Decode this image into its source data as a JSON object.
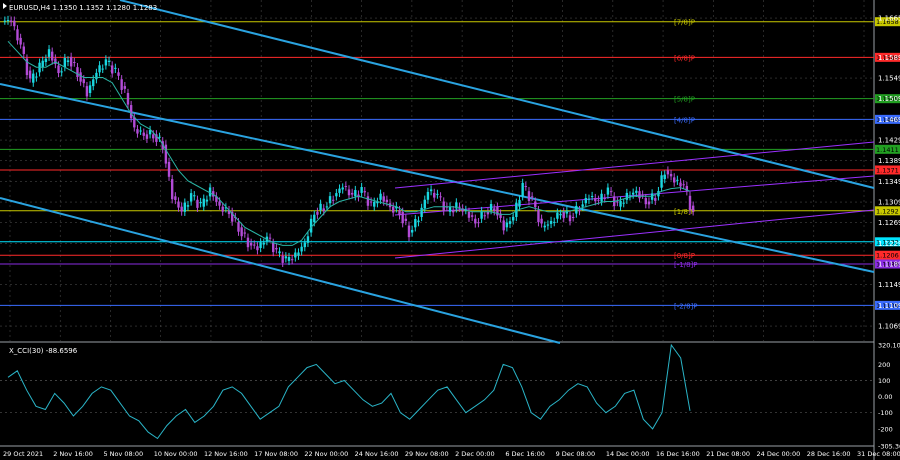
{
  "header": {
    "symbol_line": "EURUSD,H4  1.1350 1.1352 1.1280 1.1283"
  },
  "indicator": {
    "title": "X_CCI(30) -88.6596"
  },
  "chart_data": [
    {
      "type": "candlestick",
      "title": "EURUSD,H4",
      "ylim": [
        1.104,
        1.17
      ],
      "price_ticks": [
        "1.1665",
        "1.1589",
        "1.1549",
        "1.1509",
        "1.1469",
        "1.1429",
        "1.1389",
        "1.1349",
        "1.1309",
        "1.1269",
        "1.1229",
        "1.1189",
        "1.1149",
        "1.1109",
        "1.1069"
      ],
      "x_ticks": [
        "29 Oct 2021",
        "2 Nov 16:00",
        "5 Nov 08:00",
        "10 Nov 00:00",
        "12 Nov 16:00",
        "17 Nov 08:00",
        "22 Nov 00:00",
        "24 Nov 16:00",
        "29 Nov 08:00",
        "2 Dec 00:00",
        "6 Dec 16:00",
        "9 Dec 08:00",
        "14 Dec 00:00",
        "16 Dec 16:00",
        "21 Dec 08:00",
        "24 Dec 00:00",
        "28 Dec 16:00",
        "31 Dec 08:00"
      ],
      "close_path": [
        1.166,
        1.161,
        1.154,
        1.157,
        1.16,
        1.156,
        1.159,
        1.156,
        1.152,
        1.156,
        1.158,
        1.156,
        1.152,
        1.145,
        1.144,
        1.144,
        1.142,
        1.132,
        1.129,
        1.132,
        1.13,
        1.133,
        1.13,
        1.129,
        1.126,
        1.123,
        1.122,
        1.124,
        1.121,
        1.1195,
        1.1205,
        1.123,
        1.129,
        1.13,
        1.132,
        1.134,
        1.132,
        1.133,
        1.13,
        1.132,
        1.13,
        1.129,
        1.125,
        1.128,
        1.133,
        1.132,
        1.129,
        1.13,
        1.129,
        1.127,
        1.129,
        1.13,
        1.126,
        1.128,
        1.134,
        1.131,
        1.126,
        1.127,
        1.129,
        1.128,
        1.13,
        1.132,
        1.131,
        1.133,
        1.13,
        1.132,
        1.133,
        1.131,
        1.132,
        1.137,
        1.135,
        1.134,
        1.1283
      ],
      "ma_path": [
        1.162,
        1.16,
        1.158,
        1.157,
        1.157,
        1.158,
        1.157,
        1.156,
        1.155,
        1.155,
        1.155,
        1.154,
        1.151,
        1.148,
        1.146,
        1.145,
        1.143,
        1.14,
        1.137,
        1.135,
        1.134,
        1.133,
        1.132,
        1.13,
        1.128,
        1.126,
        1.125,
        1.124,
        1.123,
        1.1225,
        1.1225,
        1.1235,
        1.126,
        1.128,
        1.13,
        1.131,
        1.1315,
        1.132,
        1.1315,
        1.131,
        1.1305,
        1.13,
        1.129,
        1.129,
        1.1295,
        1.13,
        1.13,
        1.13,
        1.1295,
        1.129,
        1.129,
        1.129,
        1.1285,
        1.1285,
        1.1295,
        1.13,
        1.1295,
        1.129,
        1.129,
        1.129,
        1.1295,
        1.13,
        1.1305,
        1.131,
        1.131,
        1.1315,
        1.132,
        1.132,
        1.132,
        1.133,
        1.1335,
        1.1337,
        1.133
      ],
      "levels": [
        {
          "price": "1.1658",
          "label": "[7/8]P",
          "color": "#c8c800"
        },
        {
          "price": "1.1589",
          "label": "[6/8]P",
          "color": "#ff2a2a"
        },
        {
          "price": "1.1509",
          "label": "[5/8]P",
          "color": "#22a022"
        },
        {
          "price": "1.1469",
          "label": "[4/8]P",
          "color": "#3a6cff"
        },
        {
          "price": "1.1411",
          "label": "",
          "color": "#22a022"
        },
        {
          "price": "1.1371",
          "label": "",
          "color": "#ff2a2a"
        },
        {
          "price": "1.1292",
          "label": "[1/8]P",
          "color": "#c8c800"
        },
        {
          "price": "1.1232",
          "label": "",
          "color": "#00e5ff"
        },
        {
          "price": "1.1206",
          "label": "[0/8]P",
          "color": "#ff2a2a"
        },
        {
          "price": "1.1189",
          "label": "[-1/8]P",
          "color": "#8a2be2"
        },
        {
          "price": "1.1109",
          "label": "[-2/8]P",
          "color": "#3a6cff"
        }
      ]
    },
    {
      "type": "line",
      "title": "X_CCI(30) -88.6596",
      "ylim": [
        -300,
        320
      ],
      "y_ticks": [
        "320.1046",
        "200",
        "100",
        "0.00",
        "-100",
        "-200",
        "-305.368"
      ],
      "values": [
        120,
        160,
        40,
        -60,
        -80,
        20,
        -40,
        -120,
        -60,
        20,
        60,
        40,
        -40,
        -120,
        -150,
        -220,
        -260,
        -180,
        -120,
        -80,
        -160,
        -120,
        -60,
        40,
        60,
        20,
        -60,
        -140,
        -100,
        -60,
        60,
        120,
        180,
        200,
        140,
        80,
        100,
        40,
        -20,
        -60,
        -40,
        20,
        -100,
        -140,
        -80,
        -20,
        40,
        60,
        -20,
        -100,
        -60,
        -20,
        40,
        200,
        180,
        60,
        -100,
        -140,
        -60,
        -20,
        40,
        80,
        60,
        -40,
        -100,
        -60,
        20,
        40,
        -140,
        -200,
        -100,
        320,
        240,
        -88
      ]
    }
  ]
}
